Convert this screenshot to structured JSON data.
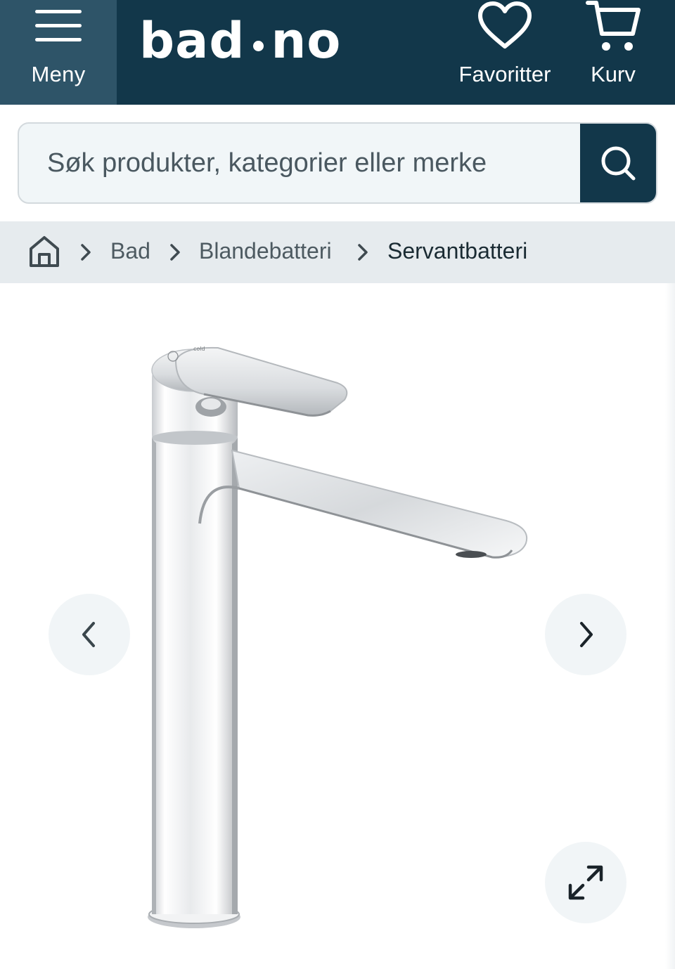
{
  "header": {
    "menu_label": "Meny",
    "logo_left": "bad",
    "logo_right": "no",
    "favorites_label": "Favoritter",
    "cart_label": "Kurv",
    "background": "#12374a",
    "menu_background": "#2e5468"
  },
  "search": {
    "placeholder": "Søk produkter, kategorier eller merke",
    "value": "",
    "icon": "search-icon"
  },
  "breadcrumb": {
    "home_icon": "home-icon",
    "items": [
      {
        "label": "Bad"
      },
      {
        "label": "Blandebatteri"
      },
      {
        "label": "Servantbatteri"
      }
    ]
  },
  "gallery": {
    "product_image": "tall-chrome-basin-faucet",
    "product_marking": "cold",
    "prev_icon": "chevron-left-icon",
    "next_icon": "chevron-right-icon",
    "fullscreen_icon": "expand-icon"
  }
}
